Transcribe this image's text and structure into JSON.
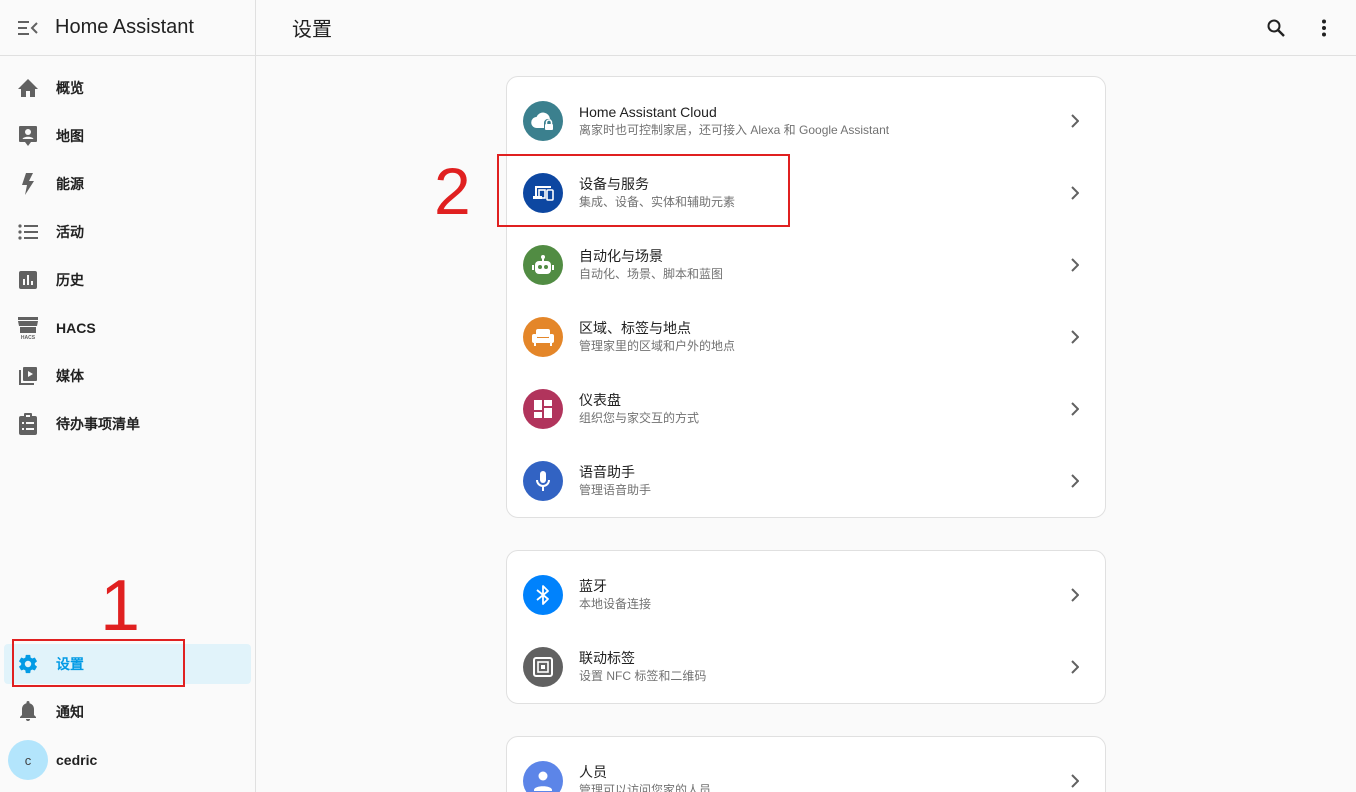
{
  "sidebar": {
    "app_title": "Home Assistant",
    "items": [
      {
        "label": "概览",
        "icon": "home-icon"
      },
      {
        "label": "地图",
        "icon": "map-account-icon"
      },
      {
        "label": "能源",
        "icon": "lightning-bolt-icon"
      },
      {
        "label": "活动",
        "icon": "format-list-bulleted-icon"
      },
      {
        "label": "历史",
        "icon": "chart-box-icon"
      },
      {
        "label": "HACS",
        "icon": "hacs-icon"
      },
      {
        "label": "媒体",
        "icon": "play-box-multiple-icon"
      },
      {
        "label": "待办事项清单",
        "icon": "clipboard-list-icon"
      }
    ],
    "settings_label": "设置",
    "notifications_label": "通知",
    "user": {
      "initial": "c",
      "name": "cedric"
    }
  },
  "topbar": {
    "title": "设置",
    "search_icon": "search-icon",
    "more_icon": "dots-vertical-icon"
  },
  "cards": [
    {
      "rows": [
        {
          "title": "Home Assistant Cloud",
          "subtitle": "离家时也可控制家居，还可接入 Alexa 和 Google Assistant",
          "color": "#3b808e",
          "icon": "cloud-lock-icon"
        },
        {
          "title": "设备与服务",
          "subtitle": "集成、设备、实体和辅助元素",
          "color": "#0d47a1",
          "icon": "devices-icon"
        },
        {
          "title": "自动化与场景",
          "subtitle": "自动化、场景、脚本和蓝图",
          "color": "#518c43",
          "icon": "robot-icon"
        },
        {
          "title": "区域、标签与地点",
          "subtitle": "管理家里的区域和户外的地点",
          "color": "#e48629",
          "icon": "sofa-icon"
        },
        {
          "title": "仪表盘",
          "subtitle": "组织您与家交互的方式",
          "color": "#b1345c",
          "icon": "view-dashboard-icon"
        },
        {
          "title": "语音助手",
          "subtitle": "管理语音助手",
          "color": "#3263c3",
          "icon": "microphone-icon"
        }
      ]
    },
    {
      "rows": [
        {
          "title": "蓝牙",
          "subtitle": "本地设备连接",
          "color": "#0082fc",
          "icon": "bluetooth-icon"
        },
        {
          "title": "联动标签",
          "subtitle": "设置 NFC 标签和二维码",
          "color": "#616161",
          "icon": "nfc-tag-icon"
        }
      ]
    },
    {
      "rows": [
        {
          "title": "人员",
          "subtitle": "管理可以访问您家的人员",
          "color": "#5c85e8",
          "icon": "account-icon"
        }
      ]
    }
  ],
  "annotations": {
    "step1": "1",
    "step2": "2",
    "color": "#e02020"
  }
}
